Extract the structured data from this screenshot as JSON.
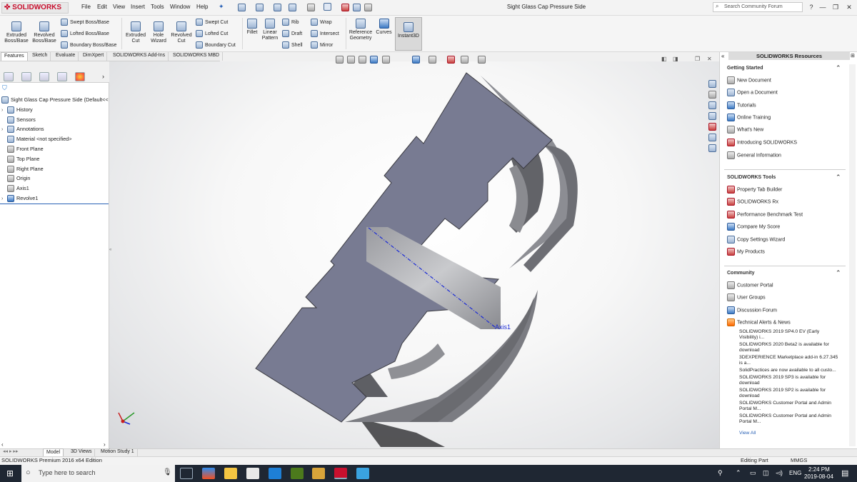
{
  "titlebar": {
    "logo": "SOLIDWORKS",
    "menus": [
      "File",
      "Edit",
      "View",
      "Insert",
      "Tools",
      "Window",
      "Help"
    ],
    "document_title": "Sight Glass Cap Pressure Side",
    "search_placeholder": "Search Community Forum",
    "window_buttons": [
      "?",
      "—",
      "❐",
      "✕"
    ]
  },
  "ribbon": {
    "extruded_boss": "Extruded Boss/Base",
    "revolved_boss": "Revolved Boss/Base",
    "swept_boss": "Swept Boss/Base",
    "lofted_boss": "Lofted Boss/Base",
    "boundary_boss": "Boundary Boss/Base",
    "extruded_cut": "Extruded Cut",
    "hole_wizard": "Hole Wizard",
    "revolved_cut": "Revolved Cut",
    "swept_cut": "Swept Cut",
    "lofted_cut": "Lofted Cut",
    "boundary_cut": "Boundary Cut",
    "fillet": "Fillet",
    "linear_pattern": "Linear Pattern",
    "rib": "Rib",
    "draft": "Draft",
    "shell": "Shell",
    "wrap": "Wrap",
    "intersect": "Intersect",
    "mirror": "Mirror",
    "reference_geometry": "Reference Geometry",
    "curves": "Curves",
    "instant3d": "Instant3D"
  },
  "command_tabs": [
    "Features",
    "Sketch",
    "Evaluate",
    "DimXpert",
    "SOLIDWORKS Add-Ins",
    "SOLIDWORKS MBD"
  ],
  "tree": {
    "root": "Sight Glass Cap Pressure Side  (Default<<",
    "items": [
      "History",
      "Sensors",
      "Annotations",
      "Material <not specified>",
      "Front Plane",
      "Top Plane",
      "Right Plane",
      "Origin",
      "Axis1",
      "Revolve1"
    ]
  },
  "viewport": {
    "axis_label": "Axis1"
  },
  "resources": {
    "header": "SOLIDWORKS Resources",
    "getting_started": {
      "title": "Getting Started",
      "items": [
        "New Document",
        "Open a Document",
        "Tutorials",
        "Online Training",
        "What's New",
        "Introducing SOLIDWORKS",
        "General Information"
      ]
    },
    "tools": {
      "title": "SOLIDWORKS Tools",
      "items": [
        "Property Tab Builder",
        "SOLIDWORKS Rx",
        "Performance Benchmark Test",
        "Compare My Score",
        "Copy Settings Wizard",
        "My Products"
      ]
    },
    "community": {
      "title": "Community",
      "items": [
        "Customer Portal",
        "User Groups",
        "Discussion Forum",
        "Technical Alerts & News"
      ],
      "news": [
        "SOLIDWORKS 2019 SP4.0 EV (Early Visibility) i...",
        "SOLIDWORKS 2020 Beta2 is available for download",
        "3DEXPERIENCE Marketplace add-in 6.27.345 is a...",
        "SolidPractices are now available to all custo...",
        "SOLIDWORKS 2019 SP3 is available for download",
        "SOLIDWORKS 2019 SP2 is available for download",
        "SOLIDWORKS Customer Portal and Admin Portal M...",
        "SOLIDWORKS Customer Portal and Admin Portal M..."
      ],
      "view_all": "View All"
    }
  },
  "bottom_tabs": [
    "Model",
    "3D Views",
    "Motion Study 1"
  ],
  "status": {
    "edition": "SOLIDWORKS Premium 2016 x64 Edition",
    "mode": "Editing Part",
    "units": "MMGS"
  },
  "taskbar": {
    "search_placeholder": "Type here to search",
    "lang": "ENG",
    "time": "2:24 PM",
    "date": "2019-08-04"
  }
}
